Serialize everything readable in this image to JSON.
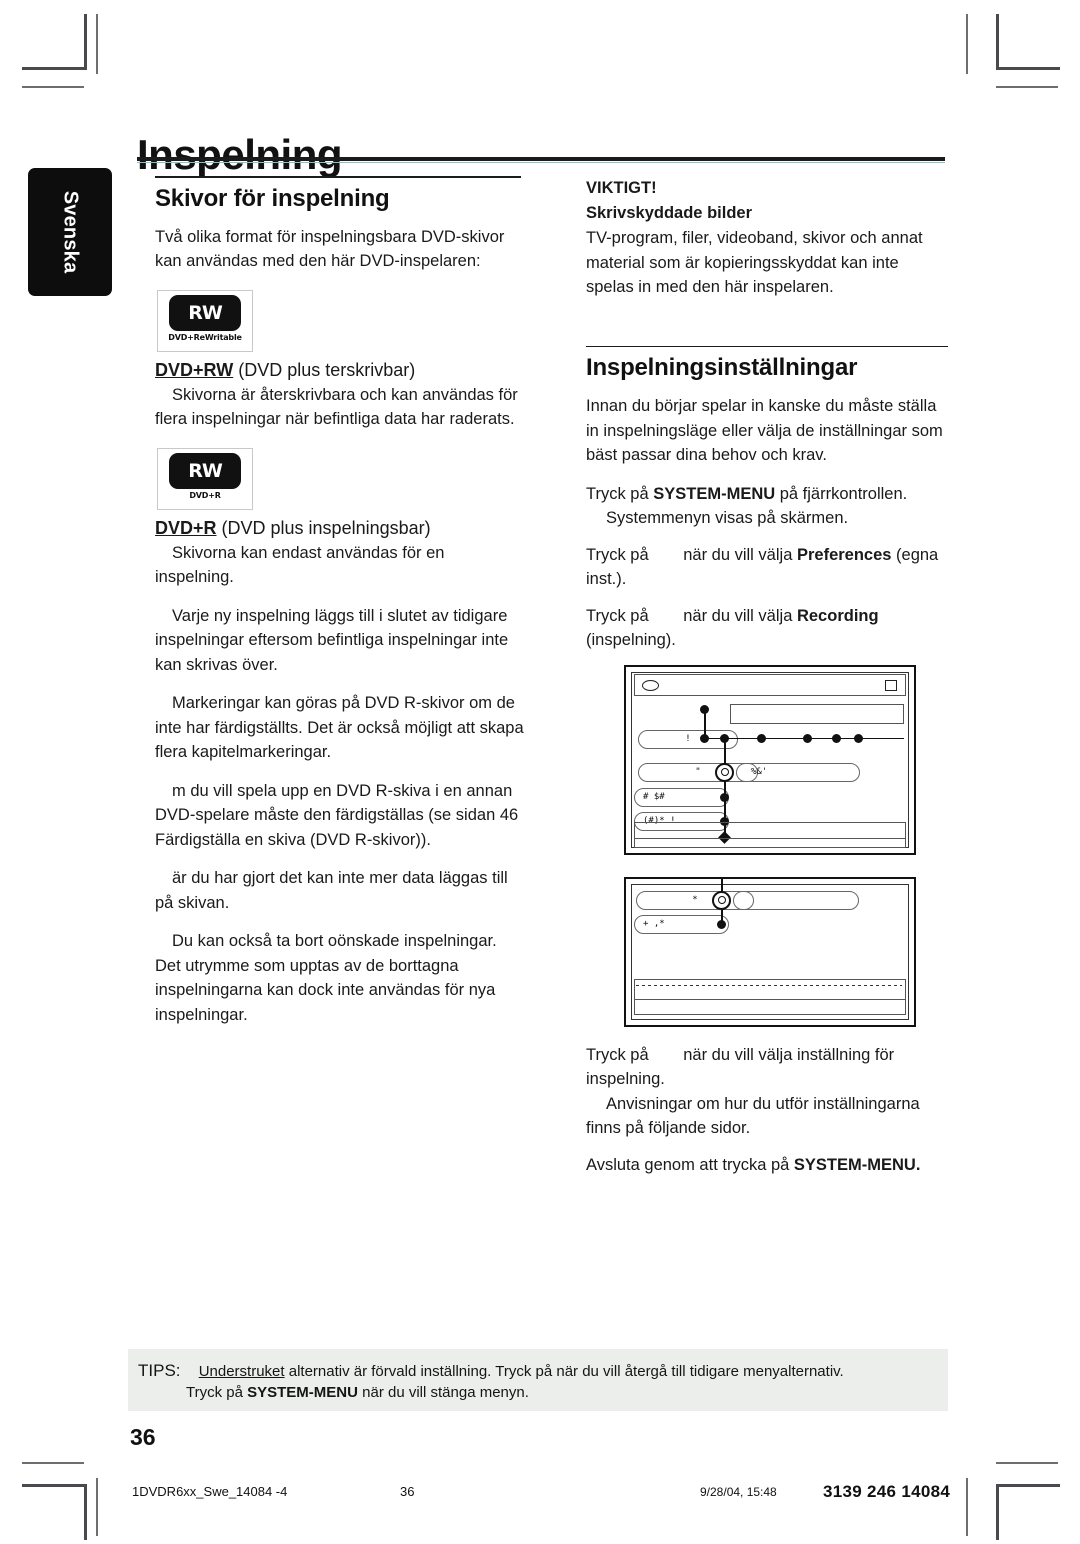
{
  "page": {
    "title": "Inspelning",
    "language_tab": "Svenska",
    "folio": "36"
  },
  "left_column": {
    "section_heading": "Skivor för inspelning",
    "intro": "Två olika format för inspelningsbara DVD-skivor kan användas med den här DVD-inspelaren:",
    "discs": [
      {
        "logo_mark": "RW",
        "logo_caption": "DVD+ReWritable",
        "title_bold": "DVD+RW",
        "title_rest": "(DVD plus  terskrivbar)",
        "paragraphs": [
          "Skivorna är återskrivbara och kan användas för flera inspelningar när befintliga data har raderats."
        ]
      },
      {
        "logo_mark": "RW",
        "logo_caption": "DVD+R",
        "title_bold": "DVD+R",
        "title_rest": "(DVD  plus  inspelningsbar)",
        "paragraphs": [
          "Skivorna kan endast användas för en inspelning.",
          "Varje ny inspelning läggs till i slutet av tidigare inspelningar eftersom befintliga inspelningar inte kan skrivas över.",
          "Markeringar kan göras på DVD  R-skivor om de inte har färdigställts. Det är också möjligt att skapa flera kapitelmarkeringar.",
          "m du vill spela upp en DVD  R-skiva i en annan DVD-spelare måste den färdigställas (se sidan 46 Färdigställa en skiva (DVD  R-skivor)).",
          "är du har gjort det kan inte mer data läggas till på skivan.",
          "Du kan också ta bort oönskade inspelningar. Det utrymme som upptas av de borttagna inspelningarna kan dock inte användas för nya inspelningar."
        ]
      }
    ]
  },
  "right_column": {
    "important": {
      "heading": "VIKTIGT!",
      "subheading": "Skrivskyddade bilder",
      "body": "TV-program, filer, videoband, skivor och annat material som är kopieringsskyddat kan inte spelas in med den här inspelaren."
    },
    "settings": {
      "heading": "Inspelningsinställningar",
      "intro": "Innan du börjar spelar in kanske du måste ställa in inspelningsläge eller välja de inställningar som bäst passar dina behov och krav.",
      "steps": [
        {
          "text_before": "Tryck på ",
          "bold": "SYSTEM-MENU",
          "text_after": " på fjärrkontrollen.",
          "sub": "Systemmenyn visas på skärmen."
        },
        {
          "text_before": "Tryck på ",
          "gap": true,
          "text_mid": "när du vill välja  ",
          "bold": "Preferences",
          "text_after": " (egna inst.)."
        },
        {
          "text_before": "Tryck på ",
          "gap": true,
          "text_mid": "när du vill välja  ",
          "bold": "Recording",
          "text_after": " (inspelning)."
        },
        {
          "text_before": "Tryck på ",
          "gap": true,
          "text_mid": "när du vill välja inställning för inspelning.",
          "sub": "Anvisningar om hur du utför inställningarna finns på följande sidor."
        },
        {
          "text_before": "Avsluta genom att trycka på ",
          "bold": "SYSTEM-MENU",
          "text_after": "."
        }
      ]
    },
    "osd_screens": [
      {
        "name": "preferences-menu-screen",
        "rows": [
          {
            "label": "!",
            "type": "pill"
          },
          {
            "label": "\"",
            "type": "pill"
          },
          {
            "label": "#  $#",
            "type": "pill"
          },
          {
            "label": "(#)* !",
            "type": "pill"
          }
        ],
        "callout": "%&'"
      },
      {
        "name": "recording-submenu-screen",
        "rows": [
          {
            "label": "*",
            "type": "pill"
          },
          {
            "label": "+ ,*",
            "type": "pill"
          }
        ],
        "callout": ""
      }
    ]
  },
  "tips": {
    "label": "TIPS:",
    "line1_underlined": "Understruket",
    "line1_rest": " alternativ är förvald inställning. Tryck på      när du vill återgå till tidigare menyalternativ.",
    "line2_before": "Tryck på ",
    "line2_bold": "SYSTEM-MENU",
    "line2_after": " när du vill stänga menyn."
  },
  "print_footer": {
    "file": "1DVDR6xx_Swe_14084 -4",
    "page": "36",
    "date": "9/28/04, 15:48",
    "code": "3139 246  14084"
  }
}
